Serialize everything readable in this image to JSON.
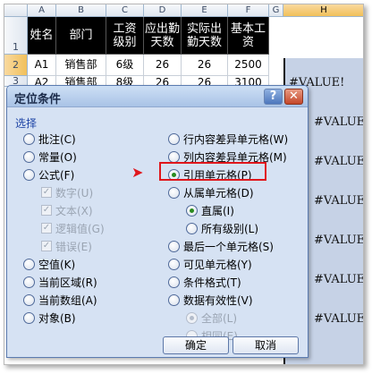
{
  "spreadsheet": {
    "columns": [
      "A",
      "B",
      "C",
      "D",
      "E",
      "F",
      "G",
      "H"
    ],
    "rows": [
      "1",
      "2",
      "3"
    ],
    "header_row": [
      "姓名",
      "部门",
      "工资\n级别",
      "应出勤\n天数",
      "实际出\n勤天数",
      "基本工\n资"
    ],
    "data_rows": [
      [
        "A1",
        "销售部",
        "6级",
        "26",
        "26",
        "2500"
      ],
      [
        "A2",
        "销售部",
        "8级",
        "26",
        "26",
        "3100"
      ]
    ],
    "error_value": "#VALUE!"
  },
  "dialog": {
    "title": "定位条件",
    "help_label": "?",
    "close_label": "✕",
    "group_label": "选择",
    "left_options": [
      {
        "label": "批注(C)",
        "checked": false
      },
      {
        "label": "常量(O)",
        "checked": false
      },
      {
        "label": "公式(F)",
        "checked": false
      }
    ],
    "formula_subitems": [
      {
        "label": "数字(U)",
        "checked": true
      },
      {
        "label": "文本(X)",
        "checked": true
      },
      {
        "label": "逻辑值(G)",
        "checked": true
      },
      {
        "label": "错误(E)",
        "checked": true
      }
    ],
    "left_options_2": [
      {
        "label": "空值(K)",
        "checked": false
      },
      {
        "label": "当前区域(R)",
        "checked": false
      },
      {
        "label": "当前数组(A)",
        "checked": false
      },
      {
        "label": "对象(B)",
        "checked": false
      }
    ],
    "right_options": [
      {
        "label": "行内容差异单元格(W)",
        "checked": false
      },
      {
        "label": "列内容差异单元格(M)",
        "checked": false
      },
      {
        "label": "引用单元格(P)",
        "checked": true
      },
      {
        "label": "从属单元格(D)",
        "checked": false
      }
    ],
    "dependent_subitems": [
      {
        "label": "直属(I)",
        "checked": true
      },
      {
        "label": "所有级别(L)",
        "checked": false
      }
    ],
    "right_options_2": [
      {
        "label": "最后一个单元格(S)",
        "checked": false
      },
      {
        "label": "可见单元格(Y)",
        "checked": false
      },
      {
        "label": "条件格式(T)",
        "checked": false
      },
      {
        "label": "数据有效性(V)",
        "checked": false
      }
    ],
    "validation_subitems": [
      {
        "label": "全部(L)",
        "checked": true
      },
      {
        "label": "相同(E)",
        "checked": false
      }
    ],
    "ok_label": "确定",
    "cancel_label": "取消"
  },
  "colors": {
    "highlight": "#e0161c",
    "dialog_bg": "#d6e2f3",
    "group_label": "#1f45a6",
    "selected_column": "#c6d2e6"
  },
  "icons": {
    "pointer_arrow": "red-arrow-icon"
  }
}
